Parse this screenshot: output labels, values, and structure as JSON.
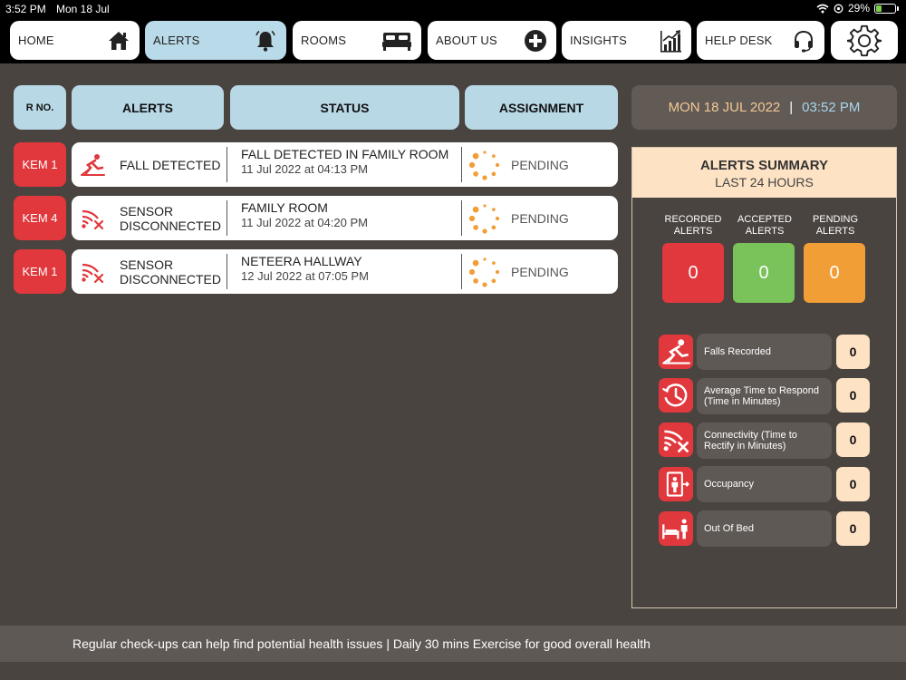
{
  "status_bar": {
    "time": "3:52 PM",
    "date": "Mon 18 Jul",
    "battery": "29%"
  },
  "nav": {
    "items": [
      {
        "label": "HOME",
        "icon": "home-icon"
      },
      {
        "label": "ALERTS",
        "icon": "bell-icon",
        "active": true
      },
      {
        "label": "ROOMS",
        "icon": "bed-icon"
      },
      {
        "label": "ABOUT US",
        "icon": "plus-circle-icon"
      },
      {
        "label": "INSIGHTS",
        "icon": "chart-icon"
      },
      {
        "label": "HELP DESK",
        "icon": "headset-icon"
      }
    ],
    "settings_icon": "gear-icon"
  },
  "table": {
    "headers": {
      "rno": "R NO.",
      "alerts": "ALERTS",
      "status": "STATUS",
      "assignment": "ASSIGNMENT"
    },
    "rows": [
      {
        "room": "KEM 1",
        "alert": "FALL DETECTED",
        "alert_icon": "fall-icon",
        "status": "FALL DETECTED IN FAMILY ROOM",
        "timestamp": "11 Jul 2022 at 04:13 PM",
        "assignment": "PENDING"
      },
      {
        "room": "KEM 4",
        "alert": "SENSOR DISCONNECTED",
        "alert_icon": "wifi-off-icon",
        "status": "FAMILY ROOM",
        "timestamp": "11 Jul 2022 at 04:20 PM",
        "assignment": "PENDING"
      },
      {
        "room": "KEM 1",
        "alert": "SENSOR DISCONNECTED",
        "alert_icon": "wifi-off-icon",
        "status": "NETEERA HALLWAY",
        "timestamp": "12 Jul 2022 at 07:05 PM",
        "assignment": "PENDING"
      }
    ]
  },
  "datetime": {
    "date": "MON 18 JUL 2022",
    "separator": "|",
    "time": "03:52 PM"
  },
  "summary": {
    "title": "ALERTS SUMMARY",
    "subtitle": "LAST 24 HOURS",
    "counts": [
      {
        "label": "RECORDED ALERTS",
        "value": "0",
        "color": "#e0383c"
      },
      {
        "label": "ACCEPTED ALERTS",
        "value": "0",
        "color": "#79c35a"
      },
      {
        "label": "PENDING ALERTS",
        "value": "0",
        "color": "#f19e37"
      }
    ],
    "stats": [
      {
        "label": "Falls Recorded",
        "value": "0",
        "icon": "fall-icon"
      },
      {
        "label": "Average Time to Respond (Time in Minutes)",
        "value": "0",
        "icon": "clock-history-icon"
      },
      {
        "label": "Connectivity (Time to Rectify in Minutes)",
        "value": "0",
        "icon": "wifi-off-icon"
      },
      {
        "label": "Occupancy",
        "value": "0",
        "icon": "occupancy-icon"
      },
      {
        "label": "Out Of Bed",
        "value": "0",
        "icon": "out-of-bed-icon"
      }
    ]
  },
  "footer": {
    "message": "Regular check-ups can help find potential health issues | Daily 30 mins Exercise for good overall health"
  },
  "colors": {
    "background": "#4a4440",
    "accent_blue": "#b8d8e6",
    "alert_red": "#e0383c",
    "pending_orange": "#f19e37",
    "peach": "#fde2c4"
  }
}
